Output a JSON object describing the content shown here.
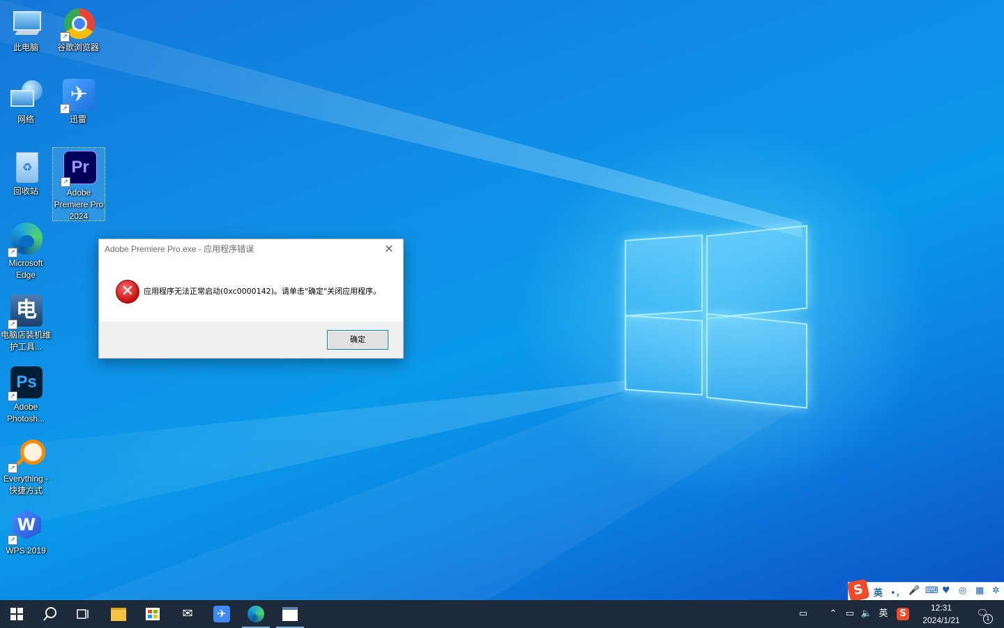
{
  "desktop": {
    "icons": [
      {
        "label": "此电脑"
      },
      {
        "label": "谷歌浏览器"
      },
      {
        "label": "网络"
      },
      {
        "label": "迅雷"
      },
      {
        "label": "回收站"
      },
      {
        "label": "Adobe Premiere Pro 2024"
      },
      {
        "label": "Microsoft Edge"
      },
      {
        "label": "电脑店装机维护工具..."
      },
      {
        "label": "Adobe Photosh..."
      },
      {
        "label": "Everything - 快捷方式"
      },
      {
        "label": "WPS 2019"
      }
    ]
  },
  "dialog": {
    "title": "Adobe Premiere Pro.exe - 应用程序错误",
    "close_glyph": "✕",
    "message": "应用程序无法正常启动(0xc0000142)。请单击\"确定\"关闭应用程序。",
    "ok_label": "确定"
  },
  "ime": {
    "logo": "S",
    "mode": "英",
    "punct": "•，",
    "icons": [
      "microphone-icon",
      "keyboard-icon",
      "skin-icon",
      "gamepad-icon",
      "toolbox-icon",
      "settings-icon"
    ]
  },
  "taskbar": {
    "tray": {
      "lang": "英",
      "ime_logo": "S",
      "time": "12:31",
      "date": "2024/1/21",
      "notification_count": "1"
    }
  }
}
